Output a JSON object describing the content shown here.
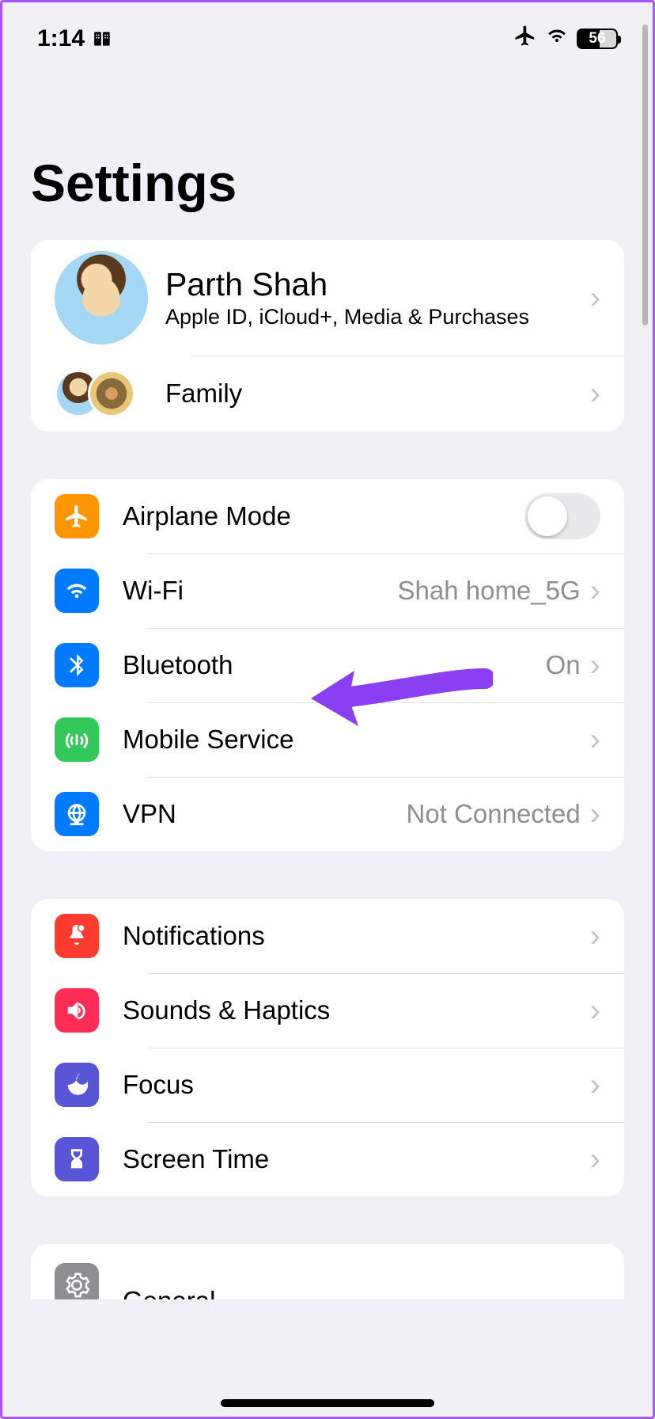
{
  "status": {
    "time": "1:14",
    "battery": "56"
  },
  "title": "Settings",
  "profile": {
    "name": "Parth Shah",
    "subtitle": "Apple ID, iCloud+, Media & Purchases",
    "family_label": "Family"
  },
  "connectivity": {
    "airplane": "Airplane Mode",
    "wifi": "Wi-Fi",
    "wifi_value": "Shah home_5G",
    "bluetooth": "Bluetooth",
    "bluetooth_value": "On",
    "mobile": "Mobile Service",
    "vpn": "VPN",
    "vpn_value": "Not Connected"
  },
  "personalization": {
    "notifications": "Notifications",
    "sounds": "Sounds & Haptics",
    "focus": "Focus",
    "screen_time": "Screen Time"
  },
  "system": {
    "general": "General"
  }
}
